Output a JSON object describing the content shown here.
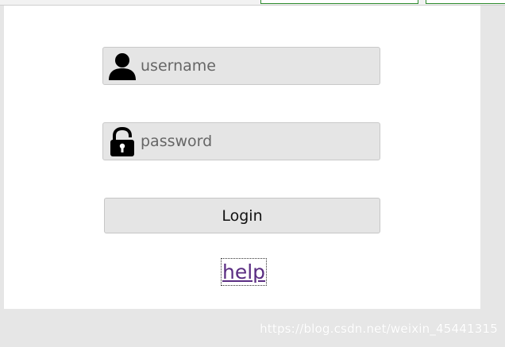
{
  "login_form": {
    "username": {
      "value": "",
      "placeholder": "username",
      "icon": "user-icon"
    },
    "password": {
      "value": "",
      "placeholder": "password",
      "icon": "lock-icon"
    },
    "login_label": "Login",
    "help_label": "help"
  },
  "watermark": "https://blog.csdn.net/weixin_45441315",
  "colors": {
    "background": "#e6e6e6",
    "panel": "#ffffff",
    "field_background": "#e5e5e5",
    "link": "#5a2d82",
    "top_tab_border": "#2e8b2e"
  }
}
